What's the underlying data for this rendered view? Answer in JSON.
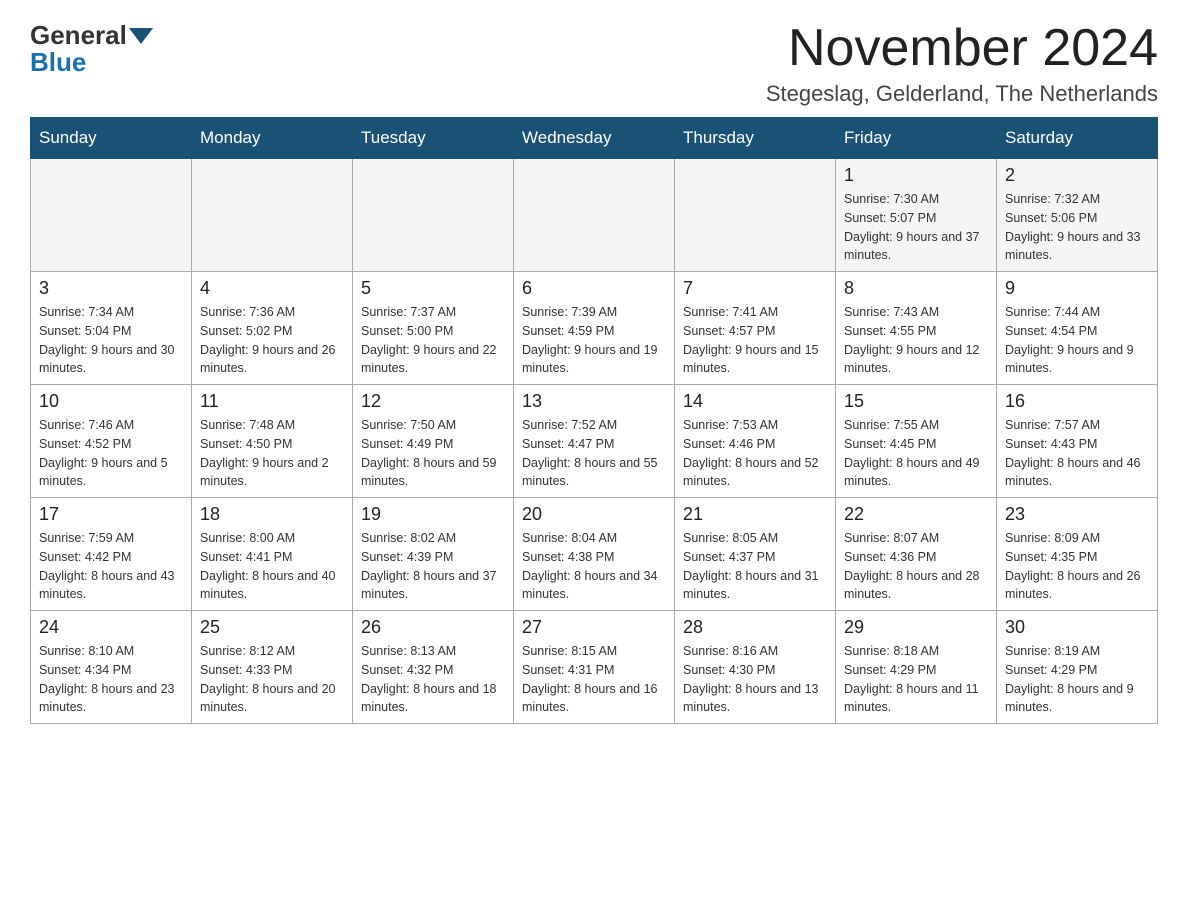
{
  "header": {
    "logo": {
      "general": "General",
      "blue": "Blue"
    },
    "title": "November 2024",
    "location": "Stegeslag, Gelderland, The Netherlands"
  },
  "calendar": {
    "weekdays": [
      "Sunday",
      "Monday",
      "Tuesday",
      "Wednesday",
      "Thursday",
      "Friday",
      "Saturday"
    ],
    "weeks": [
      [
        {
          "day": "",
          "info": ""
        },
        {
          "day": "",
          "info": ""
        },
        {
          "day": "",
          "info": ""
        },
        {
          "day": "",
          "info": ""
        },
        {
          "day": "",
          "info": ""
        },
        {
          "day": "1",
          "info": "Sunrise: 7:30 AM\nSunset: 5:07 PM\nDaylight: 9 hours and 37 minutes."
        },
        {
          "day": "2",
          "info": "Sunrise: 7:32 AM\nSunset: 5:06 PM\nDaylight: 9 hours and 33 minutes."
        }
      ],
      [
        {
          "day": "3",
          "info": "Sunrise: 7:34 AM\nSunset: 5:04 PM\nDaylight: 9 hours and 30 minutes."
        },
        {
          "day": "4",
          "info": "Sunrise: 7:36 AM\nSunset: 5:02 PM\nDaylight: 9 hours and 26 minutes."
        },
        {
          "day": "5",
          "info": "Sunrise: 7:37 AM\nSunset: 5:00 PM\nDaylight: 9 hours and 22 minutes."
        },
        {
          "day": "6",
          "info": "Sunrise: 7:39 AM\nSunset: 4:59 PM\nDaylight: 9 hours and 19 minutes."
        },
        {
          "day": "7",
          "info": "Sunrise: 7:41 AM\nSunset: 4:57 PM\nDaylight: 9 hours and 15 minutes."
        },
        {
          "day": "8",
          "info": "Sunrise: 7:43 AM\nSunset: 4:55 PM\nDaylight: 9 hours and 12 minutes."
        },
        {
          "day": "9",
          "info": "Sunrise: 7:44 AM\nSunset: 4:54 PM\nDaylight: 9 hours and 9 minutes."
        }
      ],
      [
        {
          "day": "10",
          "info": "Sunrise: 7:46 AM\nSunset: 4:52 PM\nDaylight: 9 hours and 5 minutes."
        },
        {
          "day": "11",
          "info": "Sunrise: 7:48 AM\nSunset: 4:50 PM\nDaylight: 9 hours and 2 minutes."
        },
        {
          "day": "12",
          "info": "Sunrise: 7:50 AM\nSunset: 4:49 PM\nDaylight: 8 hours and 59 minutes."
        },
        {
          "day": "13",
          "info": "Sunrise: 7:52 AM\nSunset: 4:47 PM\nDaylight: 8 hours and 55 minutes."
        },
        {
          "day": "14",
          "info": "Sunrise: 7:53 AM\nSunset: 4:46 PM\nDaylight: 8 hours and 52 minutes."
        },
        {
          "day": "15",
          "info": "Sunrise: 7:55 AM\nSunset: 4:45 PM\nDaylight: 8 hours and 49 minutes."
        },
        {
          "day": "16",
          "info": "Sunrise: 7:57 AM\nSunset: 4:43 PM\nDaylight: 8 hours and 46 minutes."
        }
      ],
      [
        {
          "day": "17",
          "info": "Sunrise: 7:59 AM\nSunset: 4:42 PM\nDaylight: 8 hours and 43 minutes."
        },
        {
          "day": "18",
          "info": "Sunrise: 8:00 AM\nSunset: 4:41 PM\nDaylight: 8 hours and 40 minutes."
        },
        {
          "day": "19",
          "info": "Sunrise: 8:02 AM\nSunset: 4:39 PM\nDaylight: 8 hours and 37 minutes."
        },
        {
          "day": "20",
          "info": "Sunrise: 8:04 AM\nSunset: 4:38 PM\nDaylight: 8 hours and 34 minutes."
        },
        {
          "day": "21",
          "info": "Sunrise: 8:05 AM\nSunset: 4:37 PM\nDaylight: 8 hours and 31 minutes."
        },
        {
          "day": "22",
          "info": "Sunrise: 8:07 AM\nSunset: 4:36 PM\nDaylight: 8 hours and 28 minutes."
        },
        {
          "day": "23",
          "info": "Sunrise: 8:09 AM\nSunset: 4:35 PM\nDaylight: 8 hours and 26 minutes."
        }
      ],
      [
        {
          "day": "24",
          "info": "Sunrise: 8:10 AM\nSunset: 4:34 PM\nDaylight: 8 hours and 23 minutes."
        },
        {
          "day": "25",
          "info": "Sunrise: 8:12 AM\nSunset: 4:33 PM\nDaylight: 8 hours and 20 minutes."
        },
        {
          "day": "26",
          "info": "Sunrise: 8:13 AM\nSunset: 4:32 PM\nDaylight: 8 hours and 18 minutes."
        },
        {
          "day": "27",
          "info": "Sunrise: 8:15 AM\nSunset: 4:31 PM\nDaylight: 8 hours and 16 minutes."
        },
        {
          "day": "28",
          "info": "Sunrise: 8:16 AM\nSunset: 4:30 PM\nDaylight: 8 hours and 13 minutes."
        },
        {
          "day": "29",
          "info": "Sunrise: 8:18 AM\nSunset: 4:29 PM\nDaylight: 8 hours and 11 minutes."
        },
        {
          "day": "30",
          "info": "Sunrise: 8:19 AM\nSunset: 4:29 PM\nDaylight: 8 hours and 9 minutes."
        }
      ]
    ]
  }
}
